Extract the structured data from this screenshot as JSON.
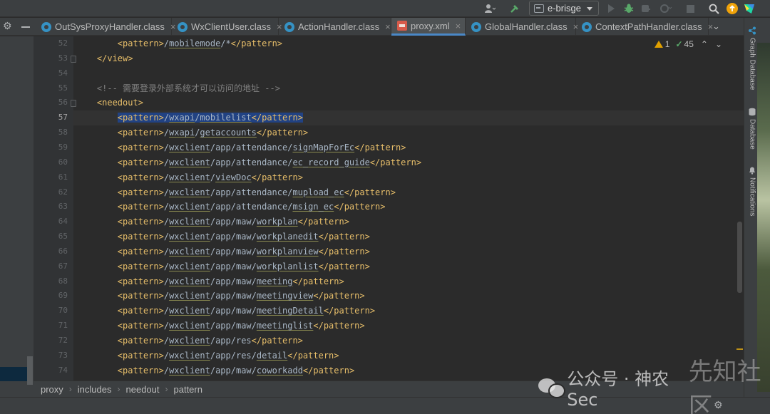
{
  "toolbar": {
    "run_config": "e-brisge"
  },
  "tabs": [
    {
      "label": "OutSysProxyHandler.class",
      "icon": "class-icon",
      "active": false
    },
    {
      "label": "WxClientUser.class",
      "icon": "class-icon",
      "active": false
    },
    {
      "label": "ActionHandler.class",
      "icon": "class-icon",
      "active": false
    },
    {
      "label": "proxy.xml",
      "icon": "xml-file-icon",
      "active": true
    },
    {
      "label": "GlobalHandler.class",
      "icon": "class-icon",
      "active": false
    },
    {
      "label": "ContextPathHandler.class",
      "icon": "class-icon",
      "active": false
    }
  ],
  "tab_close_glyph": "×",
  "inspection": {
    "warnings": "1",
    "ok": "45"
  },
  "editor": {
    "current_line": "57",
    "lines": [
      {
        "n": "52",
        "text": "        <pattern>/mobilemode/*</pattern>"
      },
      {
        "n": "53",
        "text": "    </view>"
      },
      {
        "n": "54",
        "text": ""
      },
      {
        "n": "55",
        "text": "    <!-- 需要登录外部系统才可以访问的地址 -->"
      },
      {
        "n": "56",
        "text": "    <needout>"
      },
      {
        "n": "57",
        "text": "        <pattern>/wxapi/mobilelist</pattern>"
      },
      {
        "n": "58",
        "text": "        <pattern>/wxapi/getaccounts</pattern>"
      },
      {
        "n": "59",
        "text": "        <pattern>/wxclient/app/attendance/signMapForEc</pattern>"
      },
      {
        "n": "60",
        "text": "        <pattern>/wxclient/app/attendance/ec_record_guide</pattern>"
      },
      {
        "n": "61",
        "text": "        <pattern>/wxclient/viewDoc</pattern>"
      },
      {
        "n": "62",
        "text": "        <pattern>/wxclient/app/attendance/mupload_ec</pattern>"
      },
      {
        "n": "63",
        "text": "        <pattern>/wxclient/app/attendance/msign_ec</pattern>"
      },
      {
        "n": "64",
        "text": "        <pattern>/wxclient/app/maw/workplan</pattern>"
      },
      {
        "n": "65",
        "text": "        <pattern>/wxclient/app/maw/workplanedit</pattern>"
      },
      {
        "n": "66",
        "text": "        <pattern>/wxclient/app/maw/workplanview</pattern>"
      },
      {
        "n": "67",
        "text": "        <pattern>/wxclient/app/maw/workplanlist</pattern>"
      },
      {
        "n": "68",
        "text": "        <pattern>/wxclient/app/maw/meeting</pattern>"
      },
      {
        "n": "69",
        "text": "        <pattern>/wxclient/app/maw/meetingview</pattern>"
      },
      {
        "n": "70",
        "text": "        <pattern>/wxclient/app/maw/meetingDetail</pattern>"
      },
      {
        "n": "71",
        "text": "        <pattern>/wxclient/app/maw/meetinglist</pattern>"
      },
      {
        "n": "72",
        "text": "        <pattern>/wxclient/app/res</pattern>"
      },
      {
        "n": "73",
        "text": "        <pattern>/wxclient/app/res/detail</pattern>"
      },
      {
        "n": "74",
        "text": "        <pattern>/wxclient/app/maw/coworkadd</pattern>"
      }
    ]
  },
  "breadcrumb": [
    "proxy",
    "includes",
    "needout",
    "pattern"
  ],
  "right_tools": [
    "Graph Database",
    "Database",
    "Notifications"
  ],
  "watermark": {
    "line1": "公众号 · 神农Sec",
    "line2": "先知社区"
  }
}
